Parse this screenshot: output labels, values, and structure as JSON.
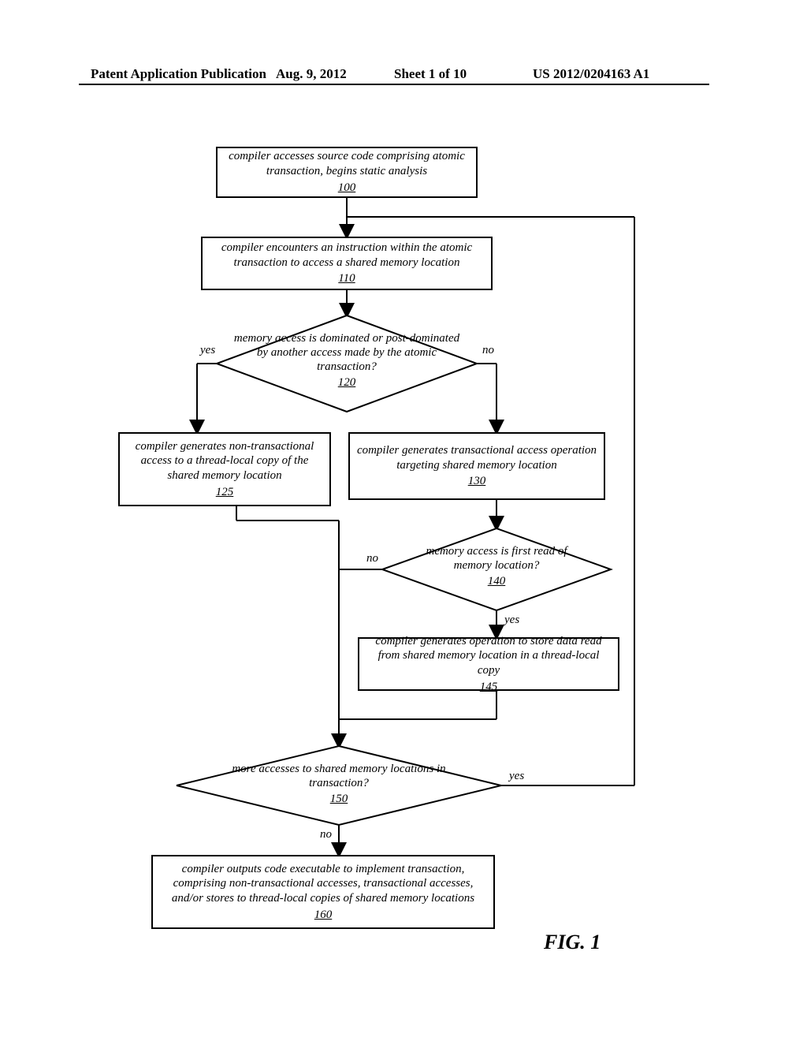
{
  "header": {
    "left": "Patent Application Publication",
    "date": "Aug. 9, 2012",
    "sheet": "Sheet 1 of 10",
    "pubno": "US 2012/0204163 A1"
  },
  "figure_label": "FIG. 1",
  "labels": {
    "yes": "yes",
    "no": "no"
  },
  "nodes": {
    "n100": {
      "text": "compiler accesses source code comprising atomic transaction, begins static analysis",
      "ref": "100"
    },
    "n110": {
      "text": "compiler encounters an instruction within the atomic transaction to access a shared memory location",
      "ref": "110"
    },
    "d120": {
      "text": "memory access is dominated or post-dominated by another access made by the atomic transaction?",
      "ref": "120"
    },
    "n125": {
      "text": "compiler generates non-transactional access to a thread-local copy of the shared memory location",
      "ref": "125"
    },
    "n130": {
      "text": "compiler generates transactional access operation targeting shared memory location",
      "ref": "130"
    },
    "d140": {
      "text": "memory access is first read of memory location?",
      "ref": "140"
    },
    "n145": {
      "text": "compiler generates operation to store data read from shared memory location in a thread-local copy",
      "ref": "145"
    },
    "d150": {
      "text": "more accesses to shared memory locations in transaction?",
      "ref": "150"
    },
    "n160": {
      "text": "compiler outputs code executable to implement transaction, comprising non-transactional accesses, transactional accesses, and/or stores to thread-local copies of shared memory locations",
      "ref": "160"
    }
  }
}
